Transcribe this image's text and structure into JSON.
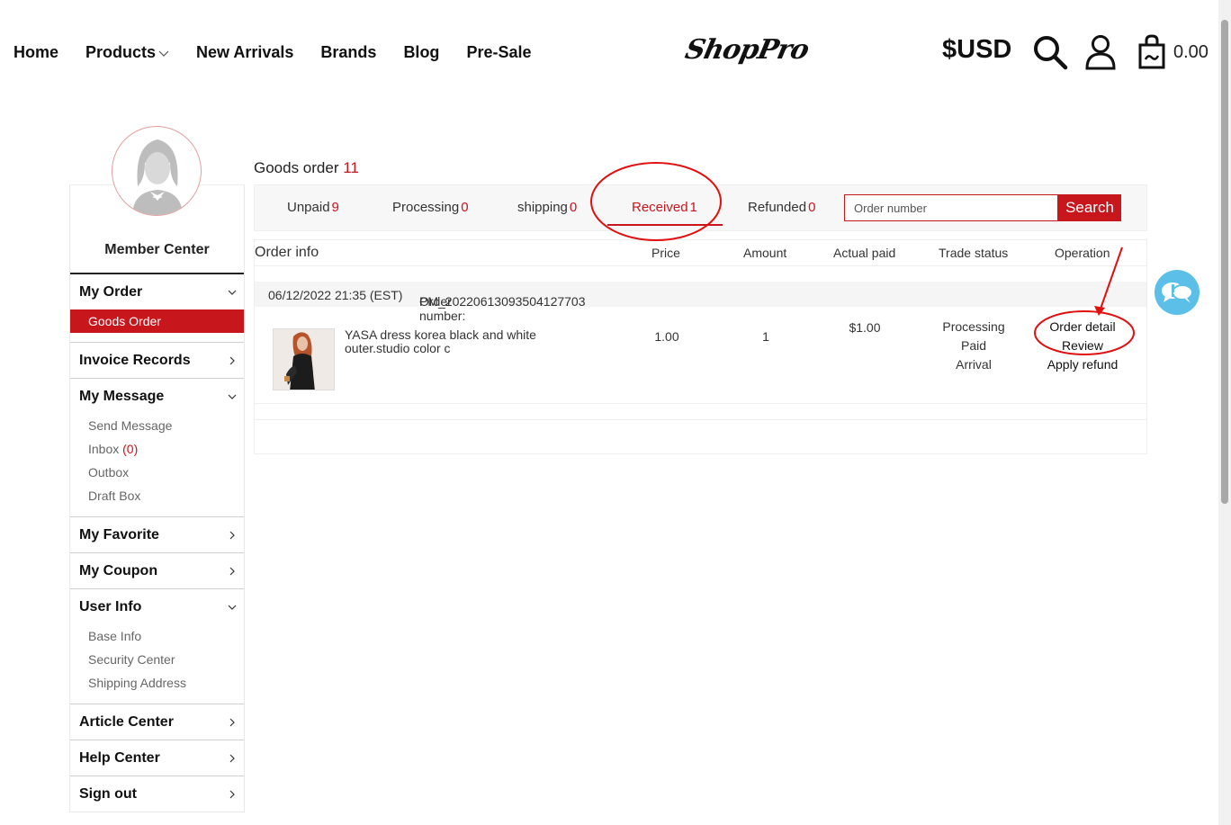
{
  "header": {
    "nav": [
      {
        "label": "Home"
      },
      {
        "label": "Products",
        "has_dropdown": true
      },
      {
        "label": "New Arrivals"
      },
      {
        "label": "Brands"
      },
      {
        "label": "Blog"
      },
      {
        "label": "Pre-Sale"
      }
    ],
    "logo": "ShopPro",
    "currency": "$USD",
    "cart_total": "0.00",
    "icons": [
      "search-icon",
      "user-icon",
      "shopping-bag-icon"
    ]
  },
  "sidebar": {
    "title": "Member Center",
    "sections": {
      "my_order": {
        "label": "My Order",
        "items": [
          "Goods Order"
        ]
      },
      "invoice": {
        "label": "Invoice Records"
      },
      "my_message": {
        "label": "My Message",
        "items": [
          "Send Message",
          "Inbox",
          "Outbox",
          "Draft Box"
        ],
        "inbox_count": "(0)"
      },
      "favorite": {
        "label": "My Favorite"
      },
      "coupon": {
        "label": "My Coupon"
      },
      "user_info": {
        "label": "User Info",
        "items": [
          "Base Info",
          "Security Center",
          "Shipping Address"
        ]
      },
      "article": {
        "label": "Article Center"
      },
      "help": {
        "label": "Help Center"
      },
      "signout": {
        "label": "Sign out"
      }
    }
  },
  "main": {
    "title": "Goods order",
    "title_count": "11",
    "tabs": [
      {
        "label": "Unpaid",
        "count": "9"
      },
      {
        "label": "Processing",
        "count": "0"
      },
      {
        "label": "shipping",
        "count": "0"
      },
      {
        "label": "Received",
        "count": "1",
        "active": true
      },
      {
        "label": "Refunded",
        "count": "0"
      }
    ],
    "search": {
      "placeholder": "Order number",
      "button": "Search"
    },
    "columns": [
      "Order info",
      "Price",
      "Amount",
      "Actual paid",
      "Trade status",
      "Operation"
    ],
    "order": {
      "date": "06/12/2022 21:35 (EST)",
      "number_label": "Order number:",
      "number": "PM_20220613093504127703",
      "item": {
        "name": "YASA dress korea black and white outer.studio color c",
        "price": "1.00",
        "amount": "1",
        "actual_paid": "$1.00"
      },
      "status": [
        "Processing",
        "Paid",
        "Arrival"
      ],
      "operations": [
        "Order detail",
        "Review",
        "Apply refund"
      ]
    }
  },
  "colors": {
    "accent": "#c8161d",
    "chat": "#5bbfe8"
  }
}
